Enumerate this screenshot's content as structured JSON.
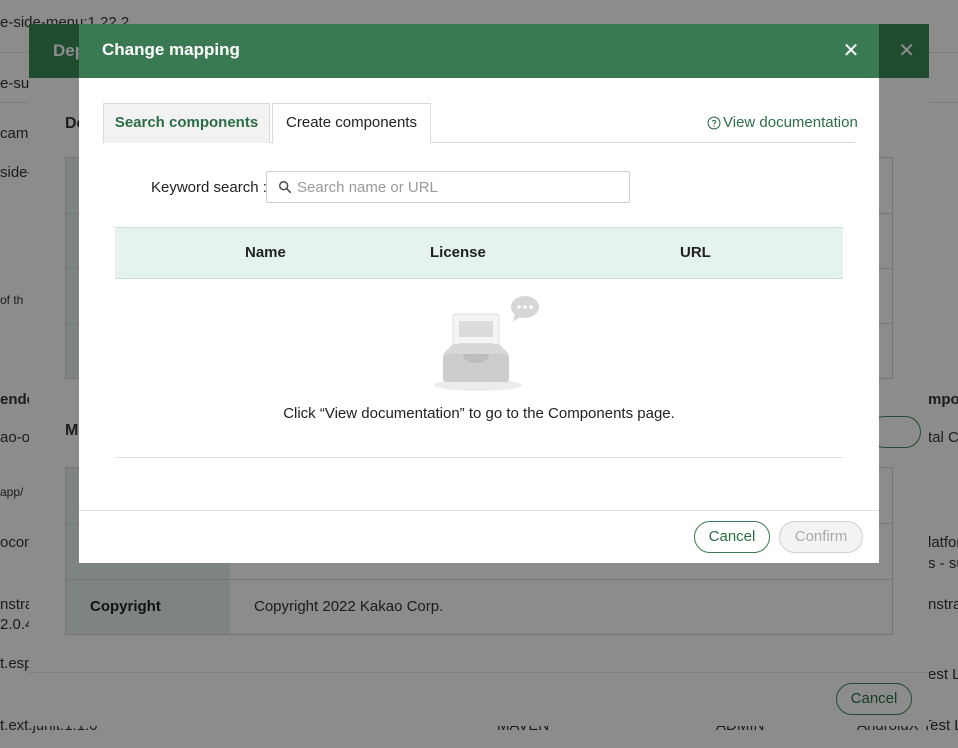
{
  "background": {
    "texts": [
      "e-side-menu:1.22.2",
      "e-sup",
      "cam",
      "side-",
      "of th",
      "ende",
      "ao-ol",
      "app/",
      "ocom",
      "nstra",
      "2.0.4",
      "t.esp",
      "t.ext.junit:1.1.0",
      "MAVEN",
      "ADMIN",
      "AndroidX Test Li",
      "mpo",
      "tal Co",
      "latfor",
      "s - su",
      "nstra",
      "est Li",
      "De",
      "Dep",
      "M"
    ],
    "middle_modal": {
      "title": "Dep",
      "copyright_label": "Copyright",
      "copyright_value": "Copyright 2022 Kakao Corp.",
      "cancel_label": "Cancel"
    }
  },
  "modal": {
    "title": "Change mapping",
    "close_icon": "close-icon",
    "tabs": [
      {
        "label": "Search components",
        "active": true
      },
      {
        "label": "Create components",
        "active": false
      }
    ],
    "doc_link": "View documentation",
    "doc_icon": "help-circle-icon",
    "keyword_label": "Keyword search :",
    "search_placeholder": "Search name or URL",
    "search_value": "",
    "search_icon": "search-icon",
    "table": {
      "columns": [
        "Name",
        "License",
        "URL"
      ],
      "rows": []
    },
    "empty_message": "Click “View documentation” to go to the Components page.",
    "empty_icon": "empty-inbox-icon",
    "buttons": {
      "cancel": "Cancel",
      "confirm": "Confirm"
    }
  },
  "colors": {
    "header_green": "#3a7a52",
    "accent_green": "#2c6e44",
    "table_header_bg": "#e4f3eb"
  }
}
